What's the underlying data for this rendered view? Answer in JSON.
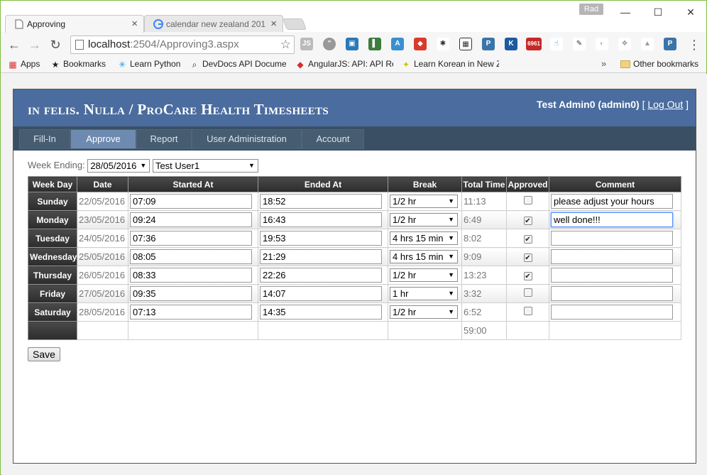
{
  "browser": {
    "tabs": [
      {
        "title": "Approving"
      },
      {
        "title": "calendar new zealand 201"
      }
    ],
    "profile_name": "Rad",
    "url_host": "localhost",
    "url_rest": ":2504/Approving3.aspx",
    "bookmarks": [
      {
        "label": "Apps"
      },
      {
        "label": "Bookmarks"
      },
      {
        "label": "Learn Python"
      },
      {
        "label": "DevDocs API Docume"
      },
      {
        "label": "AngularJS: API: API Re"
      },
      {
        "label": "Learn Korean in New Z"
      }
    ],
    "other_bookmarks": "Other bookmarks"
  },
  "header": {
    "title": "in felis. Nulla / ProCare Health Timesheets",
    "user": "Test Admin0 (admin0)",
    "bracket_open": "[",
    "logout": "Log Out",
    "bracket_close": "]"
  },
  "menu": {
    "items": [
      {
        "label": "Fill-In"
      },
      {
        "label": "Approve"
      },
      {
        "label": "Report"
      },
      {
        "label": "User Administration"
      },
      {
        "label": "Account"
      }
    ]
  },
  "filters": {
    "week_ending_label": "Week Ending:",
    "week_ending_value": "28/05/2016",
    "user_value": "Test User1"
  },
  "table": {
    "headers": {
      "week_day": "Week Day",
      "date": "Date",
      "started_at": "Started At",
      "ended_at": "Ended At",
      "break": "Break",
      "total_time": "Total Time",
      "approved": "Approved",
      "comment": "Comment"
    },
    "rows": [
      {
        "day": "Sunday",
        "date": "22/05/2016",
        "start": "07:09",
        "end": "18:52",
        "break": "1/2 hr",
        "total": "11:13",
        "approved": false,
        "comment": "please adjust your hours"
      },
      {
        "day": "Monday",
        "date": "23/05/2016",
        "start": "09:24",
        "end": "16:43",
        "break": "1/2 hr",
        "total": "6:49",
        "approved": true,
        "comment": "well done!!!"
      },
      {
        "day": "Tuesday",
        "date": "24/05/2016",
        "start": "07:36",
        "end": "19:53",
        "break": "4 hrs 15 min",
        "total": "8:02",
        "approved": true,
        "comment": ""
      },
      {
        "day": "Wednesday",
        "date": "25/05/2016",
        "start": "08:05",
        "end": "21:29",
        "break": "4 hrs 15 min",
        "total": "9:09",
        "approved": true,
        "comment": ""
      },
      {
        "day": "Thursday",
        "date": "26/05/2016",
        "start": "08:33",
        "end": "22:26",
        "break": "1/2 hr",
        "total": "13:23",
        "approved": true,
        "comment": ""
      },
      {
        "day": "Friday",
        "date": "27/05/2016",
        "start": "09:35",
        "end": "14:07",
        "break": "1 hr",
        "total": "3:32",
        "approved": false,
        "comment": ""
      },
      {
        "day": "Saturday",
        "date": "28/05/2016",
        "start": "07:13",
        "end": "14:35",
        "break": "1/2 hr",
        "total": "6:52",
        "approved": false,
        "comment": ""
      }
    ],
    "grand_total": "59:00"
  },
  "actions": {
    "save_label": "Save"
  }
}
